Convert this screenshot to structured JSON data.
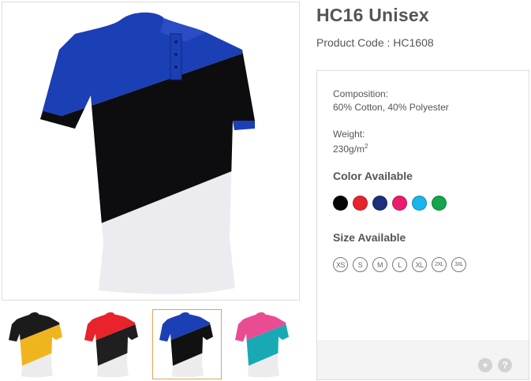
{
  "product": {
    "title": "HC16 Unisex",
    "code_label": "Product Code : ",
    "code_value": "HC1608"
  },
  "specs": {
    "composition_label": "Composition:",
    "composition_value": "60% Cotton, 40% Polyester",
    "weight_label": "Weight:",
    "weight_value": "230g/m",
    "weight_superscript": "2"
  },
  "colors": {
    "title": "Color Available",
    "swatches": [
      {
        "name": "black",
        "hex": "#050505"
      },
      {
        "name": "red",
        "hex": "#e8232b"
      },
      {
        "name": "navy",
        "hex": "#1b2f7c"
      },
      {
        "name": "pink",
        "hex": "#ec1c6c"
      },
      {
        "name": "sky-blue",
        "hex": "#16b6ec"
      },
      {
        "name": "green",
        "hex": "#14a64a"
      }
    ]
  },
  "sizes": {
    "title": "Size Available",
    "items": [
      "XS",
      "S",
      "M",
      "L",
      "XL",
      "2XL",
      "3XL"
    ]
  },
  "thumbnails": [
    {
      "name": "yellow-black",
      "top": "#1b1b1b",
      "mid": "#f0b41e",
      "bottom": "#ececec",
      "active": false
    },
    {
      "name": "red-black",
      "top": "#e8232b",
      "mid": "#1f1f1f",
      "bottom": "#ececec",
      "active": false
    },
    {
      "name": "royal-black",
      "top": "#1b3fb5",
      "mid": "#111111",
      "bottom": "#ececec",
      "active": true
    },
    {
      "name": "pink-teal",
      "top": "#e84c92",
      "mid": "#18a9b4",
      "bottom": "#ececec",
      "active": false
    }
  ],
  "footer": {
    "zoom_icon": "plus-icon",
    "help_icon": "question-icon",
    "zoom_glyph": "+",
    "help_glyph": "?"
  },
  "main_shirt": {
    "top": "#1b3fb5",
    "mid": "#0d0d0f",
    "bottom": "#ececf0"
  }
}
